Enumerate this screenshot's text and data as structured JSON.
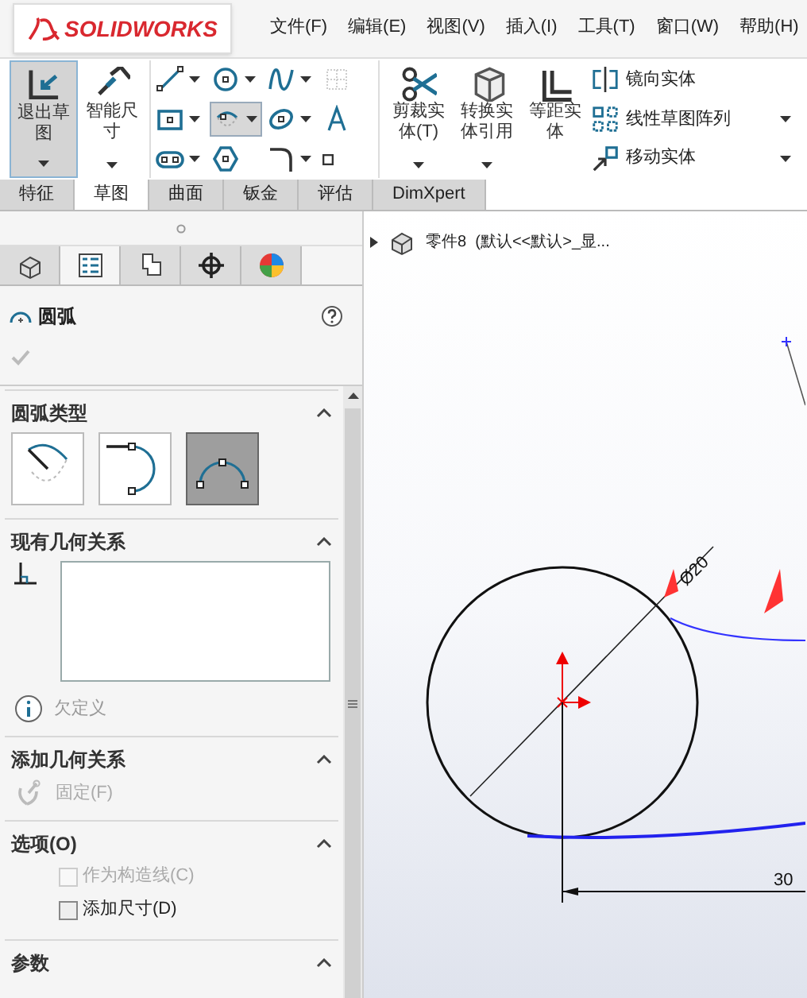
{
  "app": {
    "logo": "SOLIDWORKS"
  },
  "menu": [
    "文件(F)",
    "编辑(E)",
    "视图(V)",
    "插入(I)",
    "工具(T)",
    "窗口(W)",
    "帮助(H)"
  ],
  "ribbon": {
    "big_buttons": [
      {
        "label": "退出草图",
        "kind": "exit",
        "selected": true
      },
      {
        "label": "智能尺寸",
        "kind": "dimension",
        "selected": false
      }
    ],
    "tools": [
      {
        "kind": "line",
        "selected": false,
        "dropdown": true
      },
      {
        "kind": "circle",
        "selected": false,
        "dropdown": true
      },
      {
        "kind": "spline",
        "selected": false,
        "dropdown": true
      },
      {
        "kind": "grid",
        "selected": false,
        "dropdown": false
      },
      {
        "kind": "rect",
        "selected": false,
        "dropdown": true
      },
      {
        "kind": "arc",
        "selected": true,
        "dropdown": true
      },
      {
        "kind": "ellipse",
        "selected": false,
        "dropdown": true
      },
      {
        "kind": "text",
        "selected": false,
        "dropdown": false
      },
      {
        "kind": "slot",
        "selected": false,
        "dropdown": true
      },
      {
        "kind": "polygon",
        "selected": false,
        "dropdown": false
      },
      {
        "kind": "fillet",
        "selected": false,
        "dropdown": true
      },
      {
        "kind": "point",
        "selected": false,
        "dropdown": false
      }
    ],
    "commands": [
      {
        "label": "剪裁实体(T)",
        "kind": "trim",
        "dropdown": true
      },
      {
        "label": "转换实体引用",
        "kind": "convert",
        "dropdown": true
      },
      {
        "label": "等距实体",
        "kind": "offset",
        "dropdown": false
      }
    ],
    "list": [
      {
        "label": "镜向实体",
        "kind": "mirror",
        "dropdown": false
      },
      {
        "label": "线性草图阵列",
        "kind": "pattern",
        "dropdown": true
      },
      {
        "label": "移动实体",
        "kind": "move",
        "dropdown": true
      }
    ]
  },
  "tabs": [
    {
      "label": "特征",
      "selected": false
    },
    {
      "label": "草图",
      "selected": true
    },
    {
      "label": "曲面",
      "selected": false
    },
    {
      "label": "钣金",
      "selected": false
    },
    {
      "label": "评估",
      "selected": false
    },
    {
      "label": "DimXpert",
      "selected": false
    }
  ],
  "panel": {
    "tabs": [
      {
        "kind": "feature",
        "selected": false
      },
      {
        "kind": "property",
        "selected": true
      },
      {
        "kind": "config",
        "selected": false
      },
      {
        "kind": "dimxpert",
        "selected": false
      },
      {
        "kind": "display",
        "selected": false
      }
    ],
    "title": "圆弧",
    "arc_type": {
      "title": "圆弧类型",
      "options": [
        {
          "kind": "center",
          "selected": false
        },
        {
          "kind": "tangent",
          "selected": false
        },
        {
          "kind": "three_point",
          "selected": true
        }
      ]
    },
    "relations": {
      "title": "现有几何关系",
      "status": "欠定义"
    },
    "add_relations": {
      "title": "添加几何关系",
      "items": [
        {
          "label": "固定(F)",
          "disabled": true
        }
      ]
    },
    "options": {
      "title": "选项(O)",
      "items": [
        {
          "label": "作为构造线(C)",
          "checked": false,
          "disabled": true
        },
        {
          "label": "添加尺寸(D)",
          "checked": false,
          "disabled": false
        }
      ]
    },
    "parameters": {
      "title": "参数"
    }
  },
  "canvas": {
    "breadcrumb": "零件8  (默认<<默认>_显...",
    "diameter": "Ø20",
    "distance": "30"
  }
}
